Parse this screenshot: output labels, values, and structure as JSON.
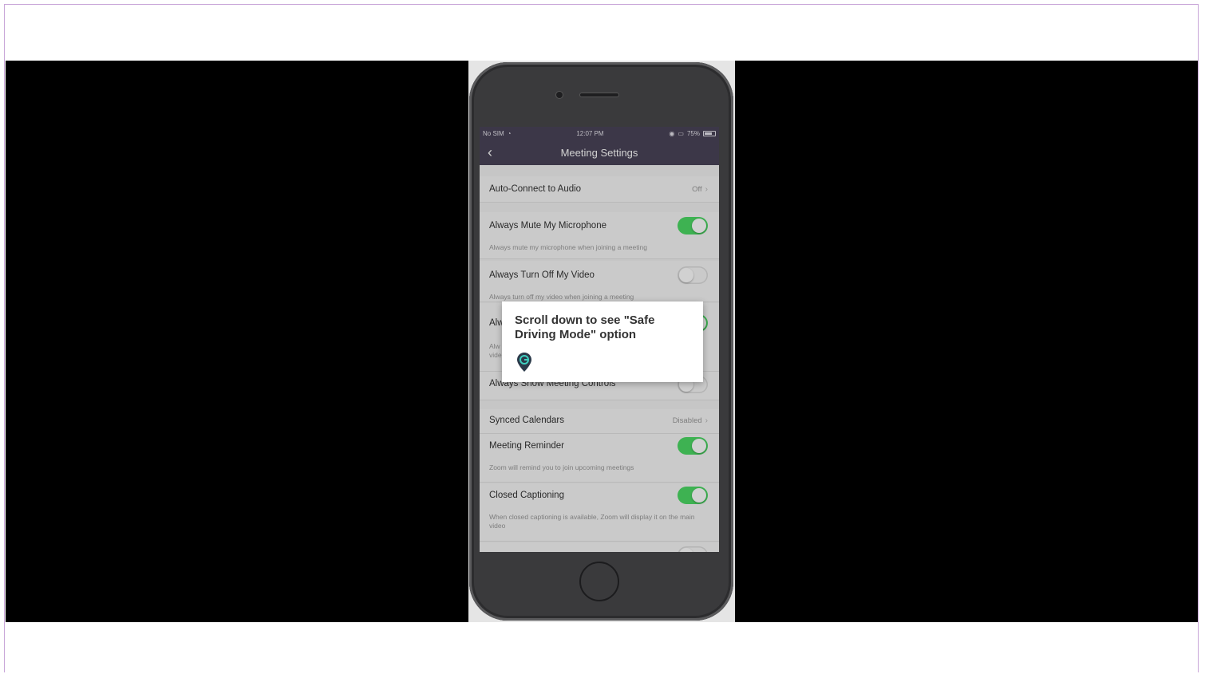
{
  "status_bar": {
    "carrier": "No SIM",
    "time": "12:07 PM",
    "battery": "75%",
    "battery_level": 0.75
  },
  "nav": {
    "title": "Meeting Settings"
  },
  "settings": {
    "auto_connect": {
      "label": "Auto-Connect to Audio",
      "value": "Off"
    },
    "mute_mic": {
      "label": "Always Mute My Microphone",
      "sub": "Always mute my microphone when joining a meeting",
      "on": true
    },
    "turn_off_video": {
      "label": "Always Turn Off My Video",
      "sub": "Always turn off my video when joining a meeting",
      "on": false
    },
    "partial_row": {
      "label": "Alw",
      "sub": "Alw\nvide",
      "on": true
    },
    "show_controls": {
      "label": "Always Show Meeting Controls",
      "on": false
    },
    "synced_calendars": {
      "label": "Synced Calendars",
      "value": "Disabled"
    },
    "meeting_reminder": {
      "label": "Meeting Reminder",
      "sub": "Zoom will remind you to join upcoming meetings",
      "on": true
    },
    "closed_captioning": {
      "label": "Closed Captioning",
      "sub": "When closed captioning is available, Zoom will display it on the main video",
      "on": true
    }
  },
  "tooltip": {
    "text": "Scroll down to see \"Safe Driving Mode\" option",
    "icon": "guide-pin-icon",
    "icon_color": "#2b3a4a"
  },
  "colors": {
    "nav_bg": "#4a4458",
    "toggle_on": "#4cd964"
  }
}
